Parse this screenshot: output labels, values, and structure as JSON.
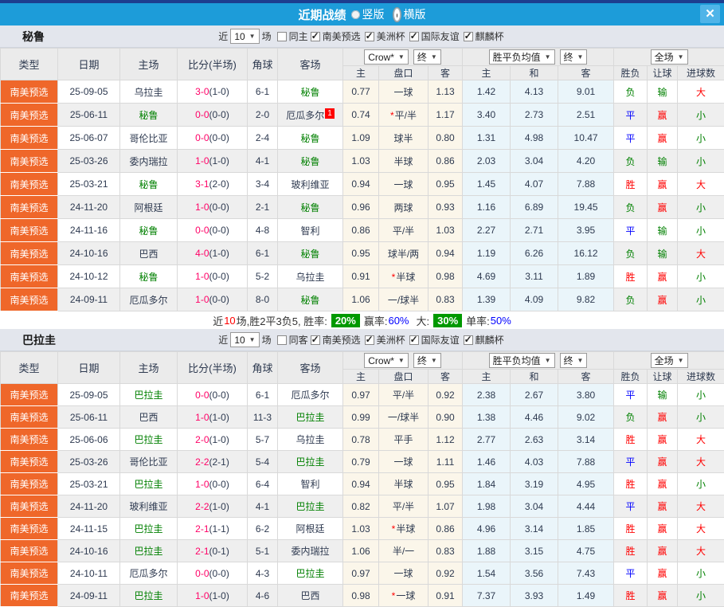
{
  "title_bar": {
    "title": "近期战绩",
    "radio_vertical": "竖版",
    "radio_horizontal": "横版",
    "close_icon": "✕"
  },
  "colors": {
    "top_strip": "#1d3d8f",
    "title_bar": "#1d9cd9",
    "section_band": "#e3e6ed",
    "header_bg": "#ebebeb",
    "type_badge_bg": "#ef672a",
    "row_alt_bg": "#efefef",
    "crow_col_bg": "#fbf6ea",
    "avg_col_bg": "#eaf5fa",
    "score_red": "#ff0066",
    "team_green": "#008000",
    "win_red": "#ff0000",
    "draw_blue": "#0000ff",
    "lose_green": "#008000",
    "summary_badge_bg": "#009900",
    "rank_badge_bg": "#ff0000"
  },
  "table_header": {
    "left": [
      "类型",
      "日期",
      "主场",
      "比分(半场)",
      "角球",
      "客场"
    ],
    "crow_dropdown": "Crow*",
    "final_dropdown": "终",
    "wdl_dropdown": "胜平负均值",
    "full_dropdown": "全场",
    "crow_cols": [
      "主",
      "盘口",
      "客"
    ],
    "avg_cols": [
      "主",
      "和",
      "客"
    ],
    "result_cols": [
      "胜负",
      "让球",
      "进球数"
    ]
  },
  "sections": [
    {
      "team": "秘鲁",
      "filters": {
        "near_label": "近",
        "count": "10",
        "unit": "场",
        "same_label": "同主",
        "same_checked": false,
        "leagues": [
          "南美预选",
          "美洲杯",
          "国际友谊",
          "麒麟杯"
        ]
      },
      "rows": [
        {
          "type": "南美预选",
          "date": "25-09-05",
          "home": "乌拉圭",
          "home_green": false,
          "score": "3-0",
          "half": "(1-0)",
          "corner": "6-1",
          "away": "秘鲁",
          "away_green": true,
          "away_badge": "",
          "crow_home": "0.77",
          "hcap_star": false,
          "hcap": "一球",
          "crow_away": "1.13",
          "avg_home": "1.42",
          "avg_draw": "4.13",
          "avg_away": "9.01",
          "res_wdl": "负",
          "res_let": "输",
          "res_goal": "大"
        },
        {
          "type": "南美预选",
          "date": "25-06-11",
          "home": "秘鲁",
          "home_green": true,
          "score": "0-0",
          "half": "(0-0)",
          "corner": "2-0",
          "away": "厄瓜多尔",
          "away_green": false,
          "away_badge": "1",
          "crow_home": "0.74",
          "hcap_star": true,
          "hcap": "平/半",
          "crow_away": "1.17",
          "avg_home": "3.40",
          "avg_draw": "2.73",
          "avg_away": "2.51",
          "res_wdl": "平",
          "res_let": "赢",
          "res_goal": "小"
        },
        {
          "type": "南美预选",
          "date": "25-06-07",
          "home": "哥伦比亚",
          "home_green": false,
          "score": "0-0",
          "half": "(0-0)",
          "corner": "2-4",
          "away": "秘鲁",
          "away_green": true,
          "away_badge": "",
          "crow_home": "1.09",
          "hcap_star": false,
          "hcap": "球半",
          "crow_away": "0.80",
          "avg_home": "1.31",
          "avg_draw": "4.98",
          "avg_away": "10.47",
          "res_wdl": "平",
          "res_let": "赢",
          "res_goal": "小"
        },
        {
          "type": "南美预选",
          "date": "25-03-26",
          "home": "委内瑞拉",
          "home_green": false,
          "score": "1-0",
          "half": "(1-0)",
          "corner": "4-1",
          "away": "秘鲁",
          "away_green": true,
          "away_badge": "",
          "crow_home": "1.03",
          "hcap_star": false,
          "hcap": "半球",
          "crow_away": "0.86",
          "avg_home": "2.03",
          "avg_draw": "3.04",
          "avg_away": "4.20",
          "res_wdl": "负",
          "res_let": "输",
          "res_goal": "小"
        },
        {
          "type": "南美预选",
          "date": "25-03-21",
          "home": "秘鲁",
          "home_green": true,
          "score": "3-1",
          "half": "(2-0)",
          "corner": "3-4",
          "away": "玻利维亚",
          "away_green": false,
          "away_badge": "",
          "crow_home": "0.94",
          "hcap_star": false,
          "hcap": "一球",
          "crow_away": "0.95",
          "avg_home": "1.45",
          "avg_draw": "4.07",
          "avg_away": "7.88",
          "res_wdl": "胜",
          "res_let": "赢",
          "res_goal": "大"
        },
        {
          "type": "南美预选",
          "date": "24-11-20",
          "home": "阿根廷",
          "home_green": false,
          "score": "1-0",
          "half": "(0-0)",
          "corner": "2-1",
          "away": "秘鲁",
          "away_green": true,
          "away_badge": "",
          "crow_home": "0.96",
          "hcap_star": false,
          "hcap": "两球",
          "crow_away": "0.93",
          "avg_home": "1.16",
          "avg_draw": "6.89",
          "avg_away": "19.45",
          "res_wdl": "负",
          "res_let": "赢",
          "res_goal": "小"
        },
        {
          "type": "南美预选",
          "date": "24-11-16",
          "home": "秘鲁",
          "home_green": true,
          "score": "0-0",
          "half": "(0-0)",
          "corner": "4-8",
          "away": "智利",
          "away_green": false,
          "away_badge": "",
          "crow_home": "0.86",
          "hcap_star": false,
          "hcap": "平/半",
          "crow_away": "1.03",
          "avg_home": "2.27",
          "avg_draw": "2.71",
          "avg_away": "3.95",
          "res_wdl": "平",
          "res_let": "输",
          "res_goal": "小"
        },
        {
          "type": "南美预选",
          "date": "24-10-16",
          "home": "巴西",
          "home_green": false,
          "score": "4-0",
          "half": "(1-0)",
          "corner": "6-1",
          "away": "秘鲁",
          "away_green": true,
          "away_badge": "",
          "crow_home": "0.95",
          "hcap_star": false,
          "hcap": "球半/两",
          "crow_away": "0.94",
          "avg_home": "1.19",
          "avg_draw": "6.26",
          "avg_away": "16.12",
          "res_wdl": "负",
          "res_let": "输",
          "res_goal": "大"
        },
        {
          "type": "南美预选",
          "date": "24-10-12",
          "home": "秘鲁",
          "home_green": true,
          "score": "1-0",
          "half": "(0-0)",
          "corner": "5-2",
          "away": "乌拉圭",
          "away_green": false,
          "away_badge": "",
          "crow_home": "0.91",
          "hcap_star": true,
          "hcap": "半球",
          "crow_away": "0.98",
          "avg_home": "4.69",
          "avg_draw": "3.11",
          "avg_away": "1.89",
          "res_wdl": "胜",
          "res_let": "赢",
          "res_goal": "小"
        },
        {
          "type": "南美预选",
          "date": "24-09-11",
          "home": "厄瓜多尔",
          "home_green": false,
          "score": "1-0",
          "half": "(0-0)",
          "corner": "8-0",
          "away": "秘鲁",
          "away_green": true,
          "away_badge": "",
          "crow_home": "1.06",
          "hcap_star": false,
          "hcap": "一/球半",
          "crow_away": "0.83",
          "avg_home": "1.39",
          "avg_draw": "4.09",
          "avg_away": "9.82",
          "res_wdl": "负",
          "res_let": "赢",
          "res_goal": "小"
        }
      ],
      "summary": {
        "lead": "近",
        "count": "10",
        "rest": "场,胜2平3负5, 胜率:",
        "win_badge": "20%",
        "label2": "赢率:",
        "value2": "60%",
        "label3": "大:",
        "big_badge": "30%",
        "label4": "单率:",
        "value4": "50%"
      }
    },
    {
      "team": "巴拉圭",
      "filters": {
        "near_label": "近",
        "count": "10",
        "unit": "场",
        "same_label": "同客",
        "same_checked": false,
        "leagues": [
          "南美预选",
          "美洲杯",
          "国际友谊",
          "麒麟杯"
        ]
      },
      "rows": [
        {
          "type": "南美预选",
          "date": "25-09-05",
          "home": "巴拉圭",
          "home_green": true,
          "score": "0-0",
          "half": "(0-0)",
          "corner": "6-1",
          "away": "厄瓜多尔",
          "away_green": false,
          "away_badge": "",
          "crow_home": "0.97",
          "hcap_star": false,
          "hcap": "平/半",
          "crow_away": "0.92",
          "avg_home": "2.38",
          "avg_draw": "2.67",
          "avg_away": "3.80",
          "res_wdl": "平",
          "res_let": "输",
          "res_goal": "小"
        },
        {
          "type": "南美预选",
          "date": "25-06-11",
          "home": "巴西",
          "home_green": false,
          "score": "1-0",
          "half": "(1-0)",
          "corner": "11-3",
          "away": "巴拉圭",
          "away_green": true,
          "away_badge": "",
          "crow_home": "0.99",
          "hcap_star": false,
          "hcap": "一/球半",
          "crow_away": "0.90",
          "avg_home": "1.38",
          "avg_draw": "4.46",
          "avg_away": "9.02",
          "res_wdl": "负",
          "res_let": "赢",
          "res_goal": "小"
        },
        {
          "type": "南美预选",
          "date": "25-06-06",
          "home": "巴拉圭",
          "home_green": true,
          "score": "2-0",
          "half": "(1-0)",
          "corner": "5-7",
          "away": "乌拉圭",
          "away_green": false,
          "away_badge": "",
          "crow_home": "0.78",
          "hcap_star": false,
          "hcap": "平手",
          "crow_away": "1.12",
          "avg_home": "2.77",
          "avg_draw": "2.63",
          "avg_away": "3.14",
          "res_wdl": "胜",
          "res_let": "赢",
          "res_goal": "大"
        },
        {
          "type": "南美预选",
          "date": "25-03-26",
          "home": "哥伦比亚",
          "home_green": false,
          "score": "2-2",
          "half": "(2-1)",
          "corner": "5-4",
          "away": "巴拉圭",
          "away_green": true,
          "away_badge": "",
          "crow_home": "0.79",
          "hcap_star": false,
          "hcap": "一球",
          "crow_away": "1.11",
          "avg_home": "1.46",
          "avg_draw": "4.03",
          "avg_away": "7.88",
          "res_wdl": "平",
          "res_let": "赢",
          "res_goal": "大"
        },
        {
          "type": "南美预选",
          "date": "25-03-21",
          "home": "巴拉圭",
          "home_green": true,
          "score": "1-0",
          "half": "(0-0)",
          "corner": "6-4",
          "away": "智利",
          "away_green": false,
          "away_badge": "",
          "crow_home": "0.94",
          "hcap_star": false,
          "hcap": "半球",
          "crow_away": "0.95",
          "avg_home": "1.84",
          "avg_draw": "3.19",
          "avg_away": "4.95",
          "res_wdl": "胜",
          "res_let": "赢",
          "res_goal": "小"
        },
        {
          "type": "南美预选",
          "date": "24-11-20",
          "home": "玻利维亚",
          "home_green": false,
          "score": "2-2",
          "half": "(1-0)",
          "corner": "4-1",
          "away": "巴拉圭",
          "away_green": true,
          "away_badge": "",
          "crow_home": "0.82",
          "hcap_star": false,
          "hcap": "平/半",
          "crow_away": "1.07",
          "avg_home": "1.98",
          "avg_draw": "3.04",
          "avg_away": "4.44",
          "res_wdl": "平",
          "res_let": "赢",
          "res_goal": "大"
        },
        {
          "type": "南美预选",
          "date": "24-11-15",
          "home": "巴拉圭",
          "home_green": true,
          "score": "2-1",
          "half": "(1-1)",
          "corner": "6-2",
          "away": "阿根廷",
          "away_green": false,
          "away_badge": "",
          "crow_home": "1.03",
          "hcap_star": true,
          "hcap": "半球",
          "crow_away": "0.86",
          "avg_home": "4.96",
          "avg_draw": "3.14",
          "avg_away": "1.85",
          "res_wdl": "胜",
          "res_let": "赢",
          "res_goal": "大"
        },
        {
          "type": "南美预选",
          "date": "24-10-16",
          "home": "巴拉圭",
          "home_green": true,
          "score": "2-1",
          "half": "(0-1)",
          "corner": "5-1",
          "away": "委内瑞拉",
          "away_green": false,
          "away_badge": "",
          "crow_home": "1.06",
          "hcap_star": false,
          "hcap": "半/一",
          "crow_away": "0.83",
          "avg_home": "1.88",
          "avg_draw": "3.15",
          "avg_away": "4.75",
          "res_wdl": "胜",
          "res_let": "赢",
          "res_goal": "大"
        },
        {
          "type": "南美预选",
          "date": "24-10-11",
          "home": "厄瓜多尔",
          "home_green": false,
          "score": "0-0",
          "half": "(0-0)",
          "corner": "4-3",
          "away": "巴拉圭",
          "away_green": true,
          "away_badge": "",
          "crow_home": "0.97",
          "hcap_star": false,
          "hcap": "一球",
          "crow_away": "0.92",
          "avg_home": "1.54",
          "avg_draw": "3.56",
          "avg_away": "7.43",
          "res_wdl": "平",
          "res_let": "赢",
          "res_goal": "小"
        },
        {
          "type": "南美预选",
          "date": "24-09-11",
          "home": "巴拉圭",
          "home_green": true,
          "score": "1-0",
          "half": "(1-0)",
          "corner": "4-6",
          "away": "巴西",
          "away_green": false,
          "away_badge": "",
          "crow_home": "0.98",
          "hcap_star": true,
          "hcap": "一球",
          "crow_away": "0.91",
          "avg_home": "7.37",
          "avg_draw": "3.93",
          "avg_away": "1.49",
          "res_wdl": "胜",
          "res_let": "赢",
          "res_goal": "小"
        }
      ]
    }
  ]
}
